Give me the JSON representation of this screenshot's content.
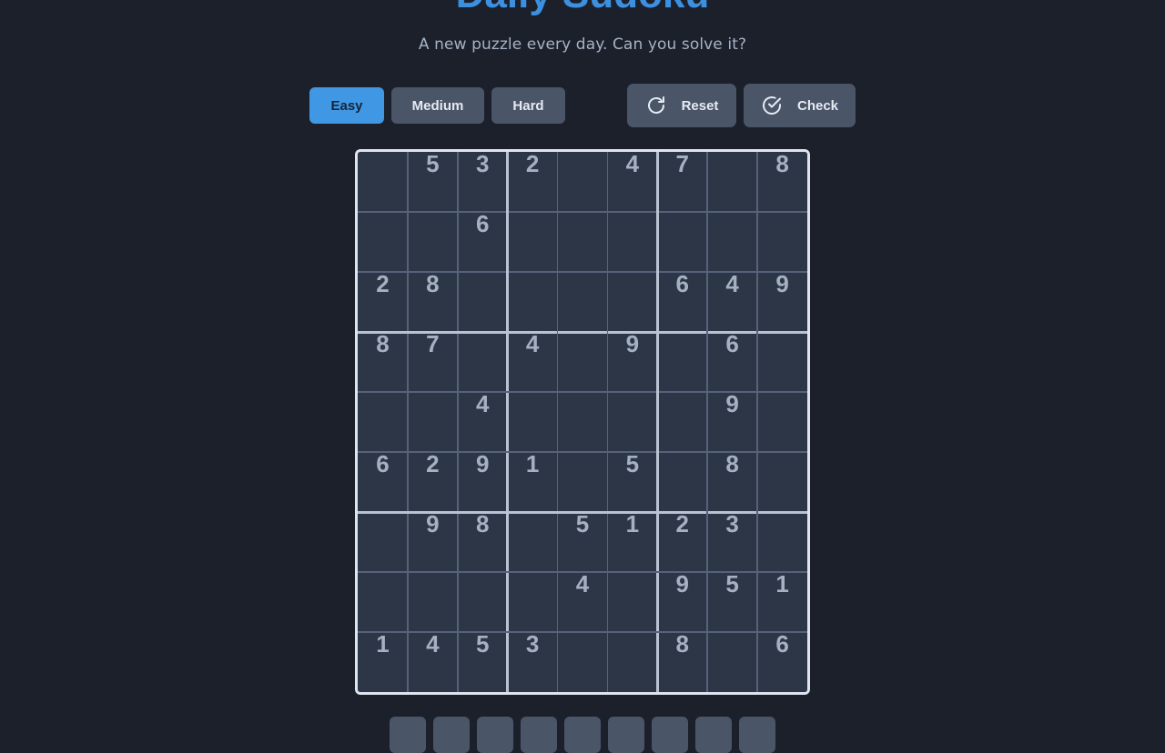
{
  "header": {
    "title": "Daily Sudoku",
    "subtitle": "A new puzzle every day. Can you solve it?"
  },
  "difficulty": {
    "options": [
      "Easy",
      "Medium",
      "Hard"
    ],
    "selected": "Easy"
  },
  "actions": {
    "reset_label": "Reset",
    "reset_icon": "rotate-icon",
    "check_label": "Check",
    "check_icon": "check-circle-icon"
  },
  "board": {
    "grid": [
      [
        "",
        "5",
        "3",
        "2",
        "",
        "4",
        "7",
        "",
        "8"
      ],
      [
        "",
        "",
        "6",
        "",
        "",
        "",
        "",
        "",
        ""
      ],
      [
        "2",
        "8",
        "",
        "",
        "",
        "",
        "6",
        "4",
        "9"
      ],
      [
        "8",
        "7",
        "",
        "4",
        "",
        "9",
        "",
        "6",
        ""
      ],
      [
        "",
        "",
        "4",
        "",
        "",
        "",
        "",
        "9",
        ""
      ],
      [
        "6",
        "2",
        "9",
        "1",
        "",
        "5",
        "",
        "8",
        ""
      ],
      [
        "",
        "9",
        "8",
        "",
        "5",
        "1",
        "2",
        "3",
        ""
      ],
      [
        "",
        "",
        "",
        "",
        "4",
        "",
        "9",
        "5",
        "1"
      ],
      [
        "1",
        "4",
        "5",
        "3",
        "",
        "",
        "8",
        "",
        "6"
      ]
    ]
  },
  "numpad": {
    "count": 9
  },
  "colors": {
    "background": "#1b202b",
    "accent": "#4098e4",
    "button": "#4b5568",
    "cell": "#2d3647",
    "given_digit": "#a5b0c2"
  }
}
